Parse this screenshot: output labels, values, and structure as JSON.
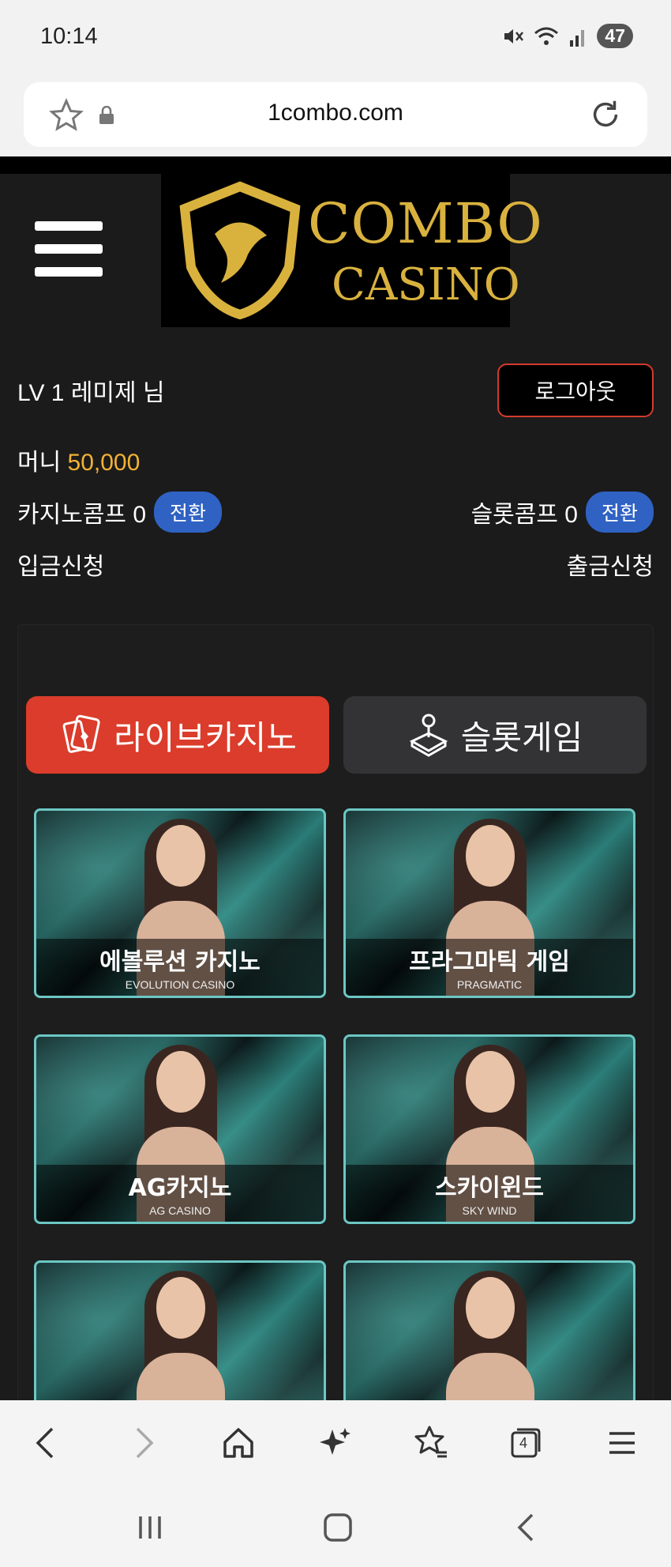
{
  "status_bar": {
    "time": "10:14",
    "battery": "47"
  },
  "browser": {
    "url": "1combo.com"
  },
  "logo": {
    "line1": "COMBO",
    "line2": "CASINO"
  },
  "user": {
    "level_text": "LV 1   레미제 님",
    "logout_label": "로그아웃"
  },
  "wallet": {
    "money_label": "머니",
    "money_value": "50,000",
    "casino_comp_label": "카지노콤프 0",
    "slot_comp_label": "슬롯콤프 0",
    "switch_label": "전환",
    "deposit_label": "입금신청",
    "withdraw_label": "출금신청"
  },
  "tabs": {
    "live_casino": "라이브카지노",
    "slot_game": "슬롯게임"
  },
  "games": [
    {
      "title": "에볼루션 카지노",
      "subtitle": "EVOLUTION CASINO"
    },
    {
      "title": "프라그마틱 게임",
      "subtitle": "PRAGMATIC"
    },
    {
      "title": "AG카지노",
      "subtitle": "AG CASINO"
    },
    {
      "title": "스카이윈드",
      "subtitle": "SKY WIND"
    },
    {
      "title": "",
      "subtitle": ""
    },
    {
      "title": "",
      "subtitle": ""
    }
  ],
  "nav": {
    "tabs_count": "4"
  },
  "colors": {
    "accent_red": "#db3c2b",
    "accent_blue": "#2f62c3",
    "money_gold": "#f2b233",
    "card_border": "#6cc7c4"
  }
}
